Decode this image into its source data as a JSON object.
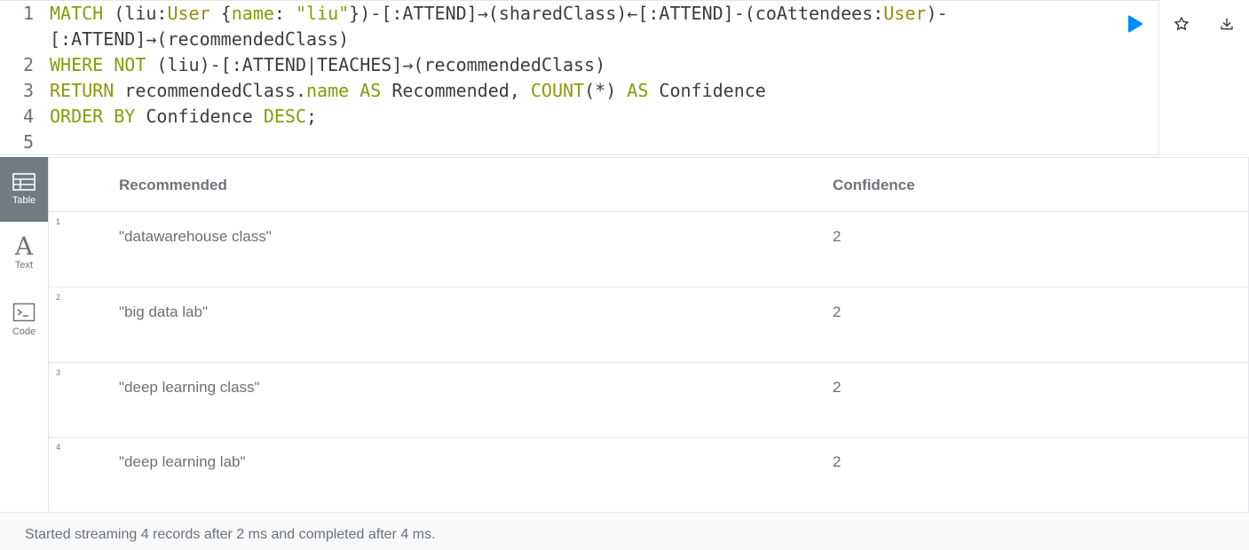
{
  "editor": {
    "lines": [
      {
        "num": "1",
        "segments": [
          {
            "t": "MATCH",
            "c": "kw"
          },
          {
            "t": " (liu:",
            "c": "pn"
          },
          {
            "t": "User",
            "c": "lab"
          },
          {
            "t": " {",
            "c": "pn"
          },
          {
            "t": "name",
            "c": "kw"
          },
          {
            "t": ": ",
            "c": "pn"
          },
          {
            "t": "\"liu\"",
            "c": "str"
          },
          {
            "t": "})-[:ATTEND]→(sharedClass)←[:ATTEND]-(coAttendees:",
            "c": "pn"
          },
          {
            "t": "User",
            "c": "lab"
          },
          {
            "t": ")-",
            "c": "pn"
          }
        ]
      },
      {
        "num": "",
        "segments": [
          {
            "t": "[:ATTEND]→(recommendedClass)",
            "c": "pn"
          }
        ]
      },
      {
        "num": "2",
        "segments": [
          {
            "t": "WHERE NOT",
            "c": "kw"
          },
          {
            "t": " (liu)-[:ATTEND|TEACHES]→(recommendedClass)",
            "c": "pn"
          }
        ]
      },
      {
        "num": "3",
        "segments": [
          {
            "t": "RETURN",
            "c": "kw"
          },
          {
            "t": " recommendedClass.",
            "c": "pn"
          },
          {
            "t": "name",
            "c": "kw"
          },
          {
            "t": " ",
            "c": "pn"
          },
          {
            "t": "AS",
            "c": "kw"
          },
          {
            "t": " Recommended, ",
            "c": "pn"
          },
          {
            "t": "COUNT",
            "c": "kw"
          },
          {
            "t": "(*) ",
            "c": "pn"
          },
          {
            "t": "AS",
            "c": "kw"
          },
          {
            "t": " Confidence",
            "c": "pn"
          }
        ]
      },
      {
        "num": "4",
        "segments": [
          {
            "t": "ORDER BY",
            "c": "kw"
          },
          {
            "t": " Confidence ",
            "c": "pn"
          },
          {
            "t": "DESC",
            "c": "kw"
          },
          {
            "t": ";",
            "c": "pn"
          }
        ]
      },
      {
        "num": "5",
        "segments": []
      }
    ]
  },
  "actions": {
    "run_icon": "play-icon",
    "favorite_icon": "star-icon",
    "download_icon": "download-icon",
    "run_color": "#018bff"
  },
  "sidebar": {
    "items": [
      {
        "label": "Table",
        "icon": "table-icon",
        "active": true
      },
      {
        "label": "Text",
        "icon": "text-icon",
        "active": false
      },
      {
        "label": "Code",
        "icon": "code-icon",
        "active": false
      }
    ]
  },
  "table": {
    "columns": [
      "Recommended",
      "Confidence"
    ],
    "rows": [
      {
        "index": "1",
        "recommended": "\"datawarehouse class\"",
        "confidence": "2"
      },
      {
        "index": "2",
        "recommended": "\"big data lab\"",
        "confidence": "2"
      },
      {
        "index": "3",
        "recommended": "\"deep learning class\"",
        "confidence": "2"
      },
      {
        "index": "4",
        "recommended": "\"deep learning lab\"",
        "confidence": "2"
      }
    ]
  },
  "footer": {
    "status": "Started streaming 4 records after 2 ms and completed after 4 ms."
  }
}
